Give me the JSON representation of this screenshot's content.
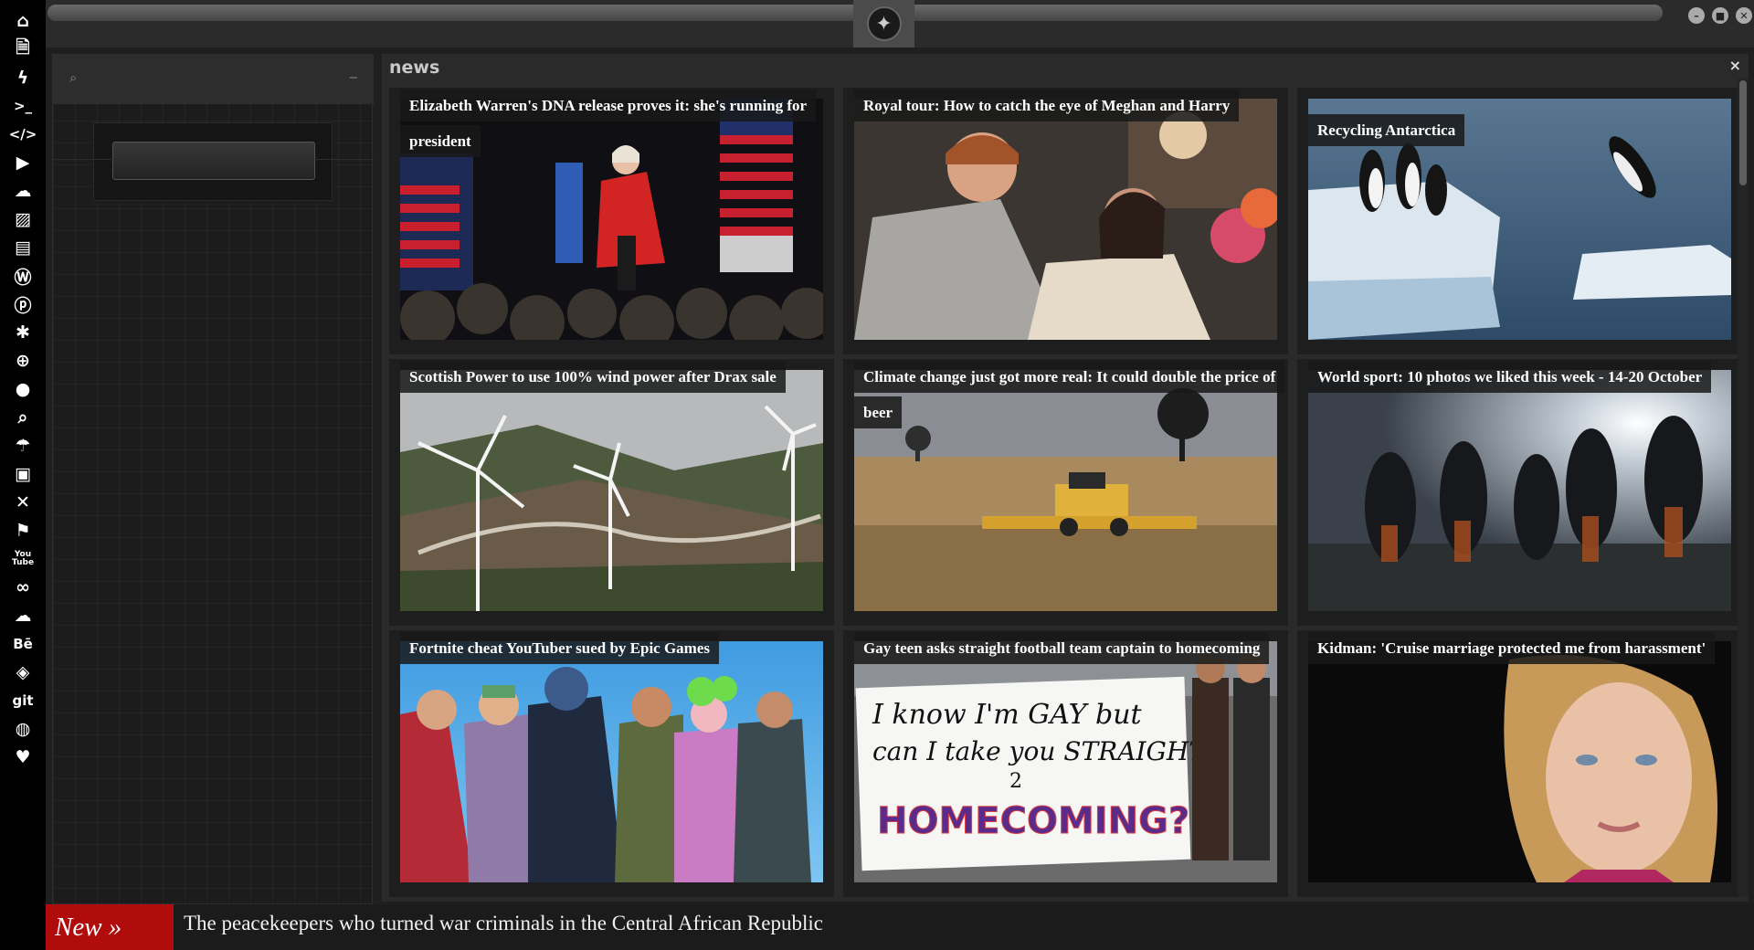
{
  "rail": {
    "icons": [
      "home-icon",
      "document-icon",
      "bolt-icon",
      "terminal-icon",
      "code-icon",
      "play-icon",
      "cloud-icon",
      "image-icon",
      "newspaper-icon",
      "wordpress-icon",
      "pinterest-icon",
      "aperture-icon",
      "dribbble-icon",
      "globe-icon",
      "search-icon",
      "umbrella-icon",
      "contact-icon",
      "expand-icon",
      "flag-icon",
      "youtube-icon",
      "infinity-icon",
      "cloud-filled-icon",
      "behance-icon",
      "codepen-icon",
      "git-icon",
      "github-icon",
      "heart-icon"
    ],
    "glyphs": [
      "⌂",
      "🗎",
      "ϟ",
      ">_",
      "</>",
      "▶",
      "☁",
      "▨",
      "▤",
      "Ⓦ",
      "ⓟ",
      "✱",
      "⊕",
      "●",
      "⌕",
      "☂",
      "▣",
      "✕",
      "⚑",
      "▶",
      "∞",
      "☁",
      "Bē",
      "◈",
      "git",
      "◍",
      "♥"
    ],
    "youtube_text": "You Tube"
  },
  "window": {
    "controls": [
      "–",
      "■",
      "✕"
    ],
    "logo": "rebel-alliance-logo"
  },
  "sidebar": {
    "search_icon": "⌕",
    "collapse": "–"
  },
  "news": {
    "title": "news",
    "close": "×",
    "articles": [
      {
        "headline": "Elizabeth Warren's DNA release proves it: she's running for president",
        "image": "warren-rally"
      },
      {
        "headline": "Royal tour: How to catch the eye of Meghan and Harry",
        "image": "royal-tour"
      },
      {
        "headline": "Recycling Antarctica",
        "image": "penguins-ice"
      },
      {
        "headline": "Scottish Power to use 100% wind power after Drax sale",
        "image": "wind-turbines"
      },
      {
        "headline": "Climate change just got more real: It could double the price of beer",
        "image": "combine-harvester"
      },
      {
        "headline": "World sport: 10 photos we liked this week - 14-20 October",
        "image": "football-players"
      },
      {
        "headline": "Fortnite cheat YouTuber sued by Epic Games",
        "image": "fortnite-characters"
      },
      {
        "headline": "Gay teen asks straight football team captain to homecoming",
        "image": "homecoming-banner"
      },
      {
        "headline": "Kidman: 'Cruise marriage protected me from harassment'",
        "image": "kidman-portrait"
      }
    ],
    "banner_text": {
      "line1": "I know I'm GAY but",
      "line2": "can I take you STRAIGHT",
      "line3": "2",
      "line4": "HOMECOMING?"
    }
  },
  "ticker": {
    "label": "New »",
    "headline": "The peacekeepers who turned war criminals in the Central African Republic"
  }
}
